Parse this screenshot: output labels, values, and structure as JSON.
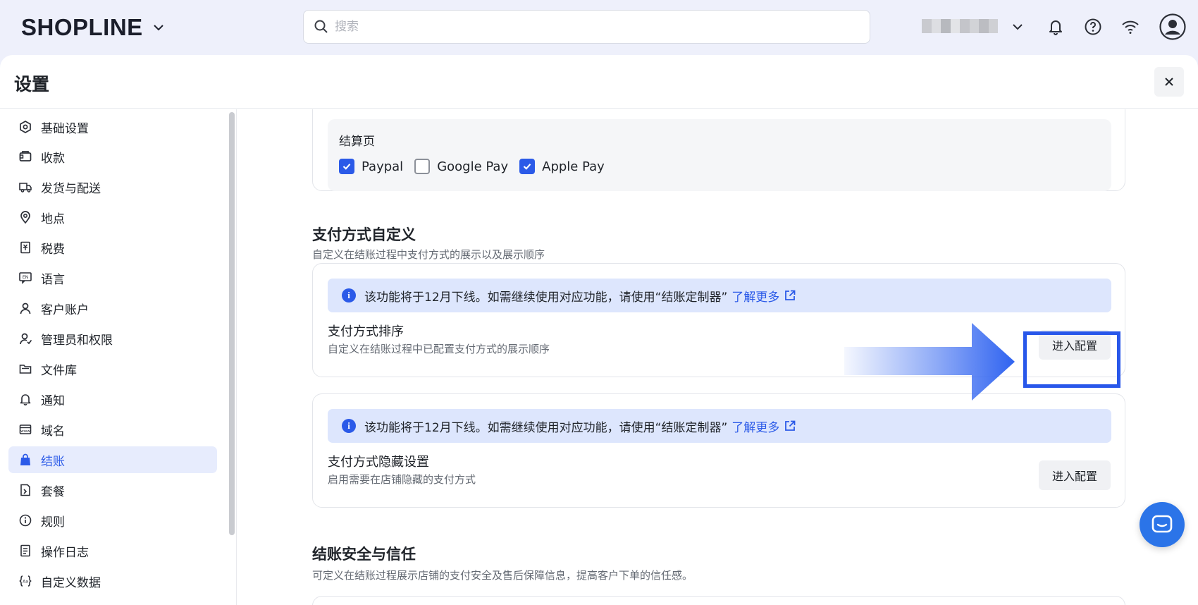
{
  "topbar": {
    "logo_text": "SHOPLINE",
    "search_placeholder": "搜索"
  },
  "page": {
    "title": "设置"
  },
  "sidebar": {
    "items": [
      {
        "label": "基础设置",
        "icon": "settings-hex-icon"
      },
      {
        "label": "收款",
        "icon": "wallet-icon"
      },
      {
        "label": "发货与配送",
        "icon": "truck-icon"
      },
      {
        "label": "地点",
        "icon": "location-pin-icon"
      },
      {
        "label": "税费",
        "icon": "tax-receipt-icon"
      },
      {
        "label": "语言",
        "icon": "language-icon"
      },
      {
        "label": "客户账户",
        "icon": "user-icon"
      },
      {
        "label": "管理员和权限",
        "icon": "admin-user-icon"
      },
      {
        "label": "文件库",
        "icon": "folder-icon"
      },
      {
        "label": "通知",
        "icon": "bell-icon"
      },
      {
        "label": "域名",
        "icon": "domain-icon"
      },
      {
        "label": "结账",
        "icon": "shopping-bag-icon",
        "active": true
      },
      {
        "label": "套餐",
        "icon": "plan-icon"
      },
      {
        "label": "规则",
        "icon": "info-circle-icon"
      },
      {
        "label": "操作日志",
        "icon": "log-icon"
      },
      {
        "label": "自定义数据",
        "icon": "custom-data-icon"
      }
    ]
  },
  "checkout_page_card": {
    "title": "结算页",
    "options": [
      {
        "label": "Paypal",
        "checked": true
      },
      {
        "label": "Google Pay",
        "checked": false
      },
      {
        "label": "Apple Pay",
        "checked": true
      }
    ]
  },
  "payment_custom": {
    "title": "支付方式自定义",
    "subtitle": "自定义在结账过程中支付方式的展示以及展示顺序",
    "notice_text": "该功能将于12月下线。如需继续使用对应功能，请使用“结账定制器”",
    "notice_link": "了解更多",
    "sort": {
      "title": "支付方式排序",
      "subtitle": "自定义在结账过程中已配置支付方式的展示顺序",
      "button": "进入配置"
    },
    "hide": {
      "title": "支付方式隐藏设置",
      "subtitle": "启用需要在店铺隐藏的支付方式",
      "button": "进入配置"
    }
  },
  "security": {
    "title": "结账安全与信任",
    "subtitle": "可定义在结账过程展示店铺的支付安全及售后保障信息，提高客户下单的信任感。"
  },
  "colors": {
    "accent": "#2b5ae8",
    "notice_bg": "#dde6fd",
    "highlight": "#2857ea"
  }
}
